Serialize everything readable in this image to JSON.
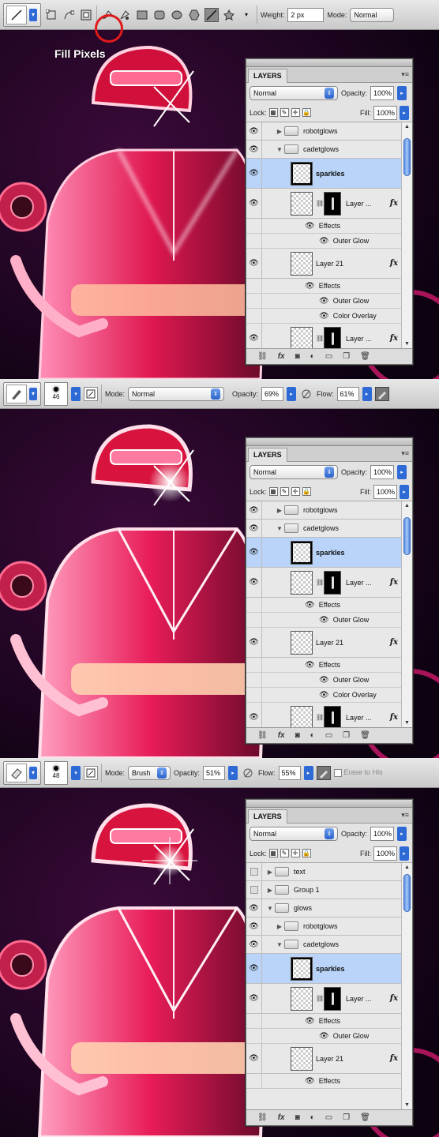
{
  "panels": [
    {
      "toolbar": {
        "caption": "Fill Pixels",
        "weight_label": "Weight:",
        "weight_value": "2 px",
        "mode_label": "Mode:",
        "mode_value": "Normal"
      },
      "layers": {
        "tab": "LAYERS",
        "blend_mode": "Normal",
        "opacity_label": "Opacity:",
        "opacity_value": "100%",
        "lock_label": "Lock:",
        "fill_label": "Fill:",
        "fill_value": "100%",
        "rows": {
          "robotglows": "robotglows",
          "cadetglows": "cadetglows",
          "sparkles": "sparkles",
          "layer_a": "Layer ...",
          "effects1": "Effects",
          "outer_glow1": "Outer Glow",
          "layer21": "Layer 21",
          "effects2": "Effects",
          "outer_glow2": "Outer Glow",
          "color_overlay": "Color Overlay",
          "layer_b": "Layer ..."
        }
      }
    },
    {
      "toolbar": {
        "brush_size": "46",
        "mode_label": "Mode:",
        "mode_value": "Normal",
        "opacity_label": "Opacity:",
        "opacity_value": "69%",
        "flow_label": "Flow:",
        "flow_value": "61%"
      },
      "layers": {
        "tab": "LAYERS",
        "blend_mode": "Normal",
        "opacity_label": "Opacity:",
        "opacity_value": "100%",
        "lock_label": "Lock:",
        "fill_label": "Fill:",
        "fill_value": "100%",
        "rows": {
          "robotglows": "robotglows",
          "cadetglows": "cadetglows",
          "sparkles": "sparkles",
          "layer_a": "Layer ...",
          "effects1": "Effects",
          "outer_glow1": "Outer Glow",
          "layer21": "Layer 21",
          "effects2": "Effects",
          "outer_glow2": "Outer Glow",
          "color_overlay": "Color Overlay",
          "layer_b": "Layer ..."
        }
      }
    },
    {
      "toolbar": {
        "brush_size": "48",
        "mode_label": "Mode:",
        "mode_value": "Brush",
        "opacity_label": "Opacity:",
        "opacity_value": "51%",
        "flow_label": "Flow:",
        "flow_value": "55%",
        "erase_history": "Erase to His"
      },
      "layers": {
        "tab": "LAYERS",
        "blend_mode": "Normal",
        "opacity_label": "Opacity:",
        "opacity_value": "100%",
        "lock_label": "Lock:",
        "fill_label": "Fill:",
        "fill_value": "100%",
        "rows": {
          "text": "text",
          "group1": "Group 1",
          "glows": "glows",
          "robotglows": "robotglows",
          "cadetglows": "cadetglows",
          "sparkles": "sparkles",
          "layer_a": "Layer ...",
          "effects1": "Effects",
          "outer_glow1": "Outer Glow",
          "layer21": "Layer 21",
          "effects2": "Effects"
        }
      }
    }
  ],
  "colors": {
    "accent_blue": "#2d6ad6",
    "selection": "#b9d4f8",
    "highlight_circle": "#e01a1a",
    "art_pink": "#e0205a",
    "art_dark": "#1a0420"
  }
}
